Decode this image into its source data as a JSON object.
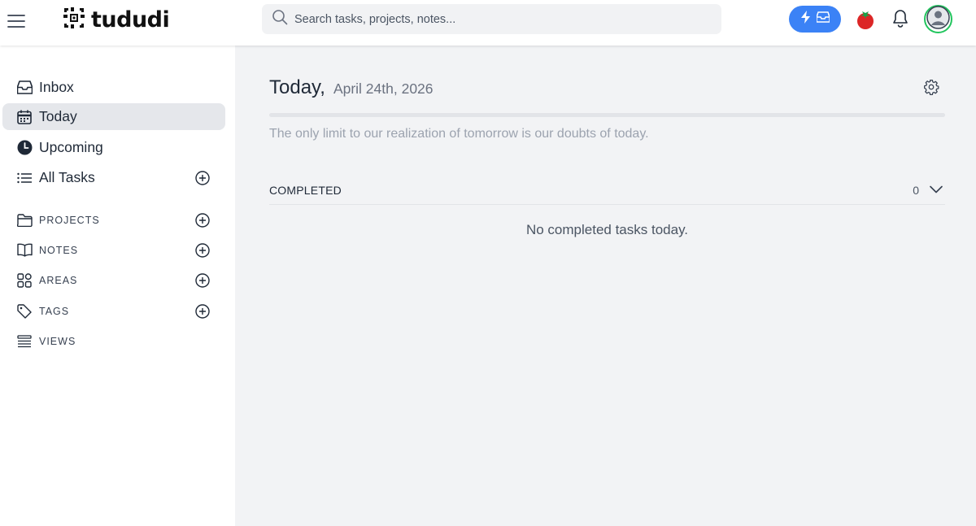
{
  "header": {
    "app_name": "tududi",
    "search_placeholder": "Search tasks, projects, notes...",
    "quick_capture_color": "#3b82f6",
    "icons": [
      "hamburger-menu-icon",
      "logo-icon",
      "search-icon",
      "lightning-icon",
      "inbox-icon",
      "tomato-timer-icon",
      "bell-icon",
      "user-icon"
    ]
  },
  "sidebar": {
    "nav": [
      {
        "label": "Inbox",
        "icon": "inbox-icon"
      },
      {
        "label": "Today",
        "icon": "calendar-icon",
        "active": true
      },
      {
        "label": "Upcoming",
        "icon": "clock-icon"
      },
      {
        "label": "All Tasks",
        "icon": "list-icon"
      }
    ],
    "sections": [
      {
        "label": "PROJECTS",
        "icon": "folder-icon"
      },
      {
        "label": "NOTES",
        "icon": "book-icon"
      },
      {
        "label": "AREAS",
        "icon": "grid-icon"
      },
      {
        "label": "TAGS",
        "icon": "tag-icon"
      },
      {
        "label": "VIEWS",
        "icon": "views-icon"
      }
    ]
  },
  "main": {
    "title": "Today,",
    "date": "April 24th, 2026",
    "progress_fraction": 0,
    "quote": "The only limit to our realization of tomorrow is our doubts of today.",
    "completed": {
      "label": "COMPLETED",
      "count": "0",
      "empty_message": "No completed tasks today."
    }
  }
}
